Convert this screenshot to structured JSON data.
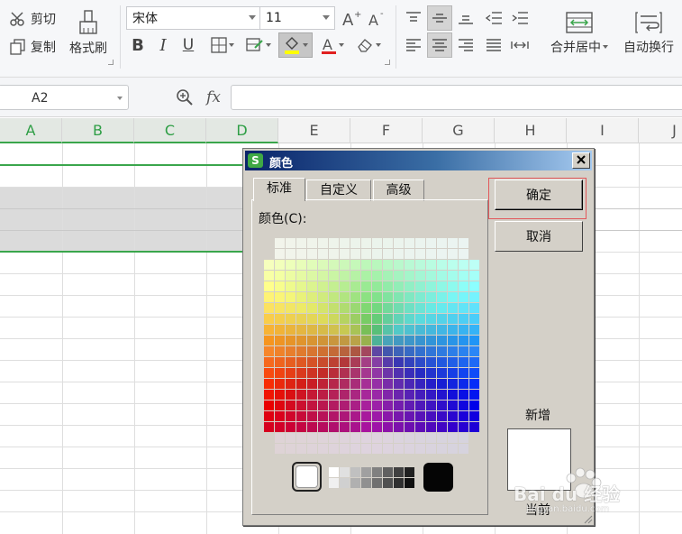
{
  "ribbon": {
    "cut_label": "剪切",
    "copy_label": "复制",
    "format_painter_label": "格式刷",
    "font_name": "宋体",
    "font_size": "11",
    "merge_center_label": "合并居中",
    "auto_wrap_label": "自动换行"
  },
  "formula_bar": {
    "cell_reference": "A2",
    "fx_label": "fx",
    "formula_value": ""
  },
  "sheet": {
    "columns": [
      "A",
      "B",
      "C",
      "D",
      "E",
      "F",
      "G",
      "H",
      "I",
      "J"
    ],
    "selected_columns": [
      "A",
      "B",
      "C",
      "D"
    ],
    "selection_color": "#dbdbdb",
    "accent_color": "#3aa64c"
  },
  "dialog": {
    "title": "颜色",
    "app_icon_letter": "S",
    "tabs": [
      "标准",
      "自定义",
      "高级"
    ],
    "active_tab": "标准",
    "color_label": "颜色(C):",
    "ok_label": "确定",
    "cancel_label": "取消",
    "new_label": "新增",
    "current_label": "当前",
    "new_color": "#ffffff",
    "current_color": "#ffffff",
    "selected_color": "#ffffff"
  },
  "watermark": {
    "brand": "Bai du 经验",
    "url": "jingyan.baidu.com"
  }
}
